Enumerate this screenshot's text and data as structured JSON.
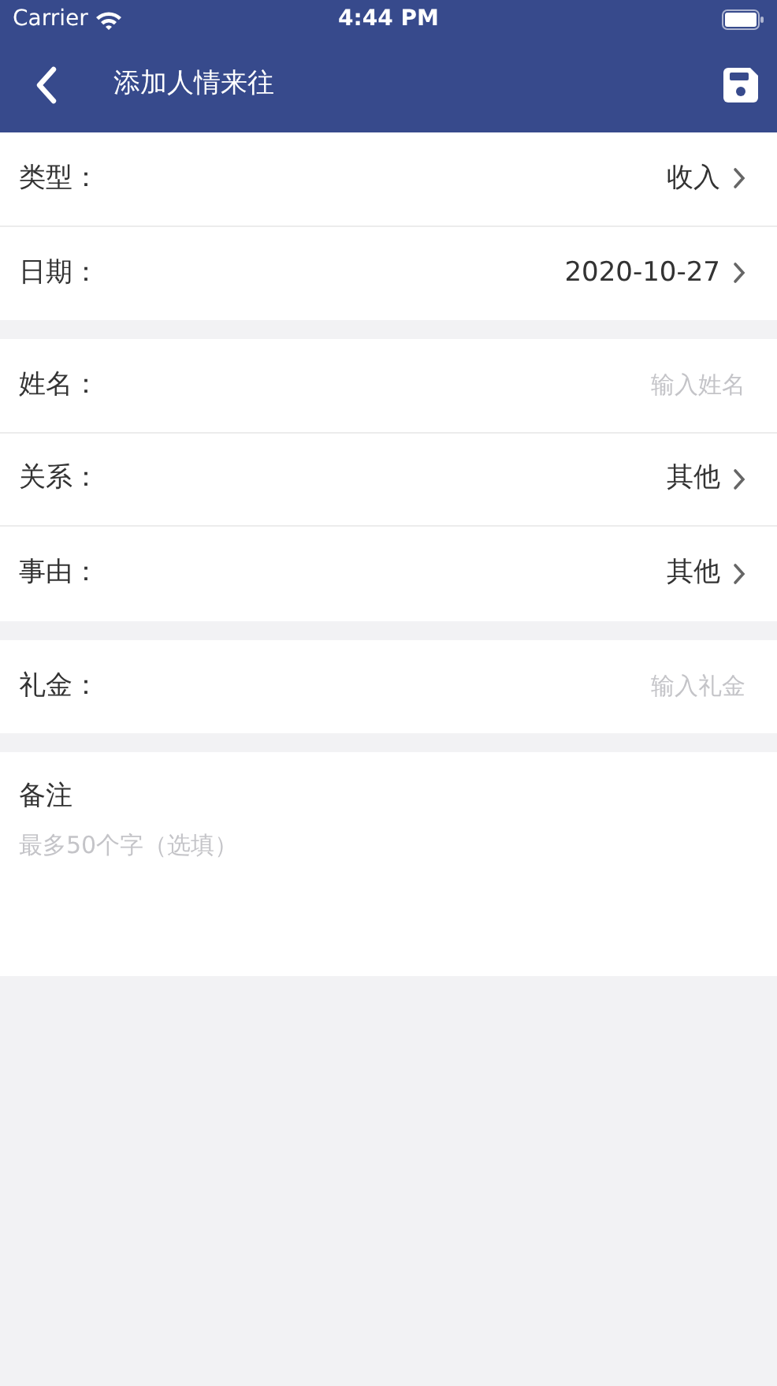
{
  "status_bar": {
    "carrier": "Carrier",
    "time": "4:44 PM"
  },
  "nav": {
    "title": "添加人情来往"
  },
  "sections": [
    {
      "rows": [
        {
          "kind": "select",
          "label": "类型：",
          "value": "收入"
        },
        {
          "kind": "select",
          "label": "日期：",
          "value": "2020-10-27"
        }
      ]
    },
    {
      "rows": [
        {
          "kind": "input",
          "label": "姓名：",
          "placeholder": "输入姓名"
        },
        {
          "kind": "select",
          "label": "关系：",
          "value": "其他"
        },
        {
          "kind": "select",
          "label": "事由：",
          "value": "其他"
        }
      ]
    },
    {
      "rows": [
        {
          "kind": "input",
          "label": "礼金：",
          "placeholder": "输入礼金"
        }
      ]
    }
  ],
  "notes": {
    "label": "备注",
    "placeholder": "最多50个字（选填）"
  }
}
